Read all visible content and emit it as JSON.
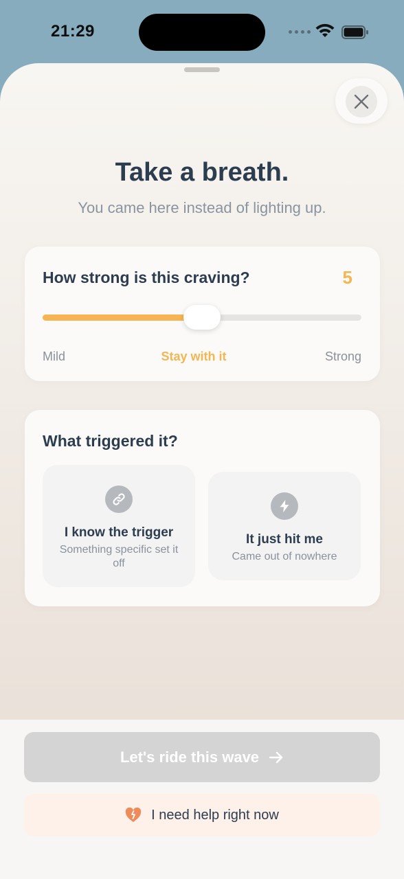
{
  "status_bar": {
    "time": "21:29"
  },
  "header": {
    "title": "Take a breath.",
    "subtitle": "You came here instead of lighting up."
  },
  "craving": {
    "question": "How strong is this craving?",
    "value": "5",
    "min": 1,
    "max": 10,
    "level_fraction": 0.5,
    "scale_min_label": "Mild",
    "scale_mid_label": "Stay with it",
    "scale_max_label": "Strong"
  },
  "trigger": {
    "question": "What triggered it?",
    "options": [
      {
        "icon": "link-icon",
        "title": "I know the trigger",
        "description": "Something specific set it off"
      },
      {
        "icon": "lightning-icon",
        "title": "It just hit me",
        "description": "Came out of nowhere"
      }
    ]
  },
  "actions": {
    "primary_label": "Let's ride this wave",
    "help_label": "I need help right now"
  },
  "colors": {
    "accent": "#f4b553",
    "title_text": "#2c3d50",
    "muted_text": "#8a94a0",
    "disabled_button": "#d4d4d4",
    "help_background": "#fdf1ea",
    "help_icon": "#ef8a5b"
  }
}
